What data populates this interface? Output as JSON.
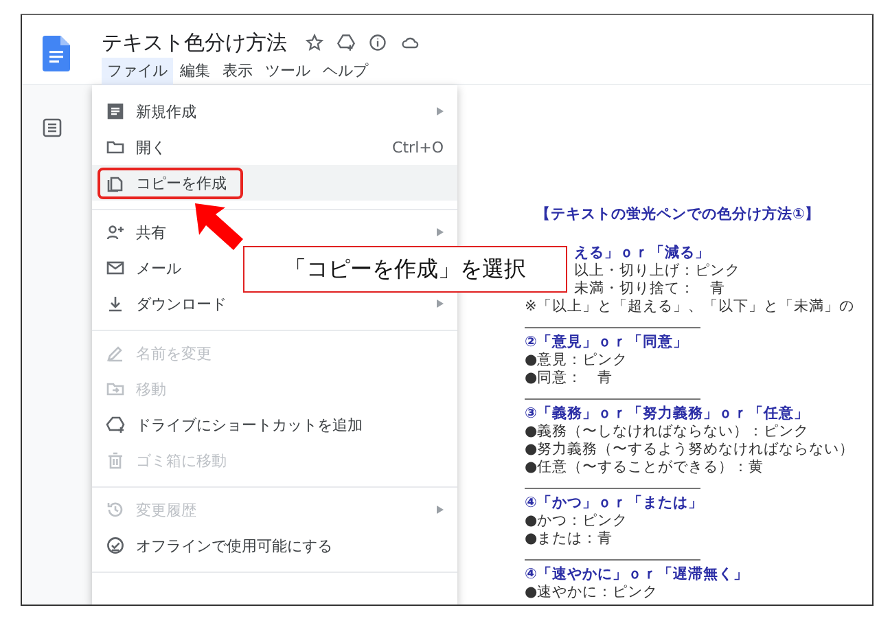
{
  "document": {
    "title": "テキスト色分け方法"
  },
  "menubar": [
    {
      "label": "ファイル",
      "selected": true
    },
    {
      "label": "編集",
      "selected": false
    },
    {
      "label": "表示",
      "selected": false
    },
    {
      "label": "ツール",
      "selected": false
    },
    {
      "label": "ヘルプ",
      "selected": false
    }
  ],
  "file_menu": {
    "sections": [
      [
        {
          "label": "新規作成",
          "submenu": true,
          "disabled": false,
          "selected": false
        },
        {
          "label": "開く",
          "shortcut": "Ctrl+O",
          "submenu": false,
          "disabled": false,
          "selected": false
        },
        {
          "label": "コピーを作成",
          "submenu": false,
          "disabled": false,
          "selected": true
        }
      ],
      [
        {
          "label": "共有",
          "submenu": true,
          "disabled": false,
          "selected": false
        },
        {
          "label": "メール",
          "submenu": false,
          "disabled": false,
          "selected": false
        },
        {
          "label": "ダウンロード",
          "submenu": true,
          "disabled": false,
          "selected": false
        }
      ],
      [
        {
          "label": "名前を変更",
          "submenu": false,
          "disabled": true,
          "selected": false
        },
        {
          "label": "移動",
          "submenu": false,
          "disabled": true,
          "selected": false
        },
        {
          "label": "ドライブにショートカットを追加",
          "submenu": false,
          "disabled": false,
          "selected": false
        },
        {
          "label": "ゴミ箱に移動",
          "submenu": false,
          "disabled": true,
          "selected": false
        }
      ],
      [
        {
          "label": "変更履歴",
          "submenu": true,
          "disabled": true,
          "selected": false
        },
        {
          "label": "オフラインで使用可能にする",
          "submenu": false,
          "disabled": false,
          "selected": false
        }
      ]
    ]
  },
  "callout": {
    "text": "「コピーを作成」を選択"
  },
  "page_lines": [
    {
      "kind": "heading",
      "text": "【テキストの蛍光ペンでの色分け方法①】"
    },
    {
      "kind": "partial-heading",
      "text": "える」ｏｒ「減る」"
    },
    {
      "kind": "partial",
      "text": "以上・切り上げ：ピンク"
    },
    {
      "kind": "partial",
      "text": "未満・切り捨て：　青"
    },
    {
      "kind": "text",
      "text": "※「以上」と「超える」、「以下」と「未満」の"
    },
    {
      "kind": "rule"
    },
    {
      "kind": "heading",
      "text": "②「意見」ｏｒ「同意」"
    },
    {
      "kind": "text",
      "text": "●意見：ピンク"
    },
    {
      "kind": "text",
      "text": "●同意：　青"
    },
    {
      "kind": "rule"
    },
    {
      "kind": "heading",
      "text": "③「義務」ｏｒ「努力義務」ｏｒ「任意」"
    },
    {
      "kind": "text",
      "text": "●義務（〜しなければならない）：ピンク"
    },
    {
      "kind": "text",
      "text": "●努力義務（〜するよう努めなければならない）"
    },
    {
      "kind": "text",
      "text": "●任意（〜することができる）：黄"
    },
    {
      "kind": "rule"
    },
    {
      "kind": "heading",
      "text": "④「かつ」ｏｒ「または」"
    },
    {
      "kind": "text",
      "text": "●かつ：ピンク"
    },
    {
      "kind": "text",
      "text": "●または：青"
    },
    {
      "kind": "rule"
    },
    {
      "kind": "heading",
      "text": "④「速やかに」ｏｒ「遅滞無く」"
    },
    {
      "kind": "text",
      "text": "●速やかに：ピンク"
    }
  ]
}
